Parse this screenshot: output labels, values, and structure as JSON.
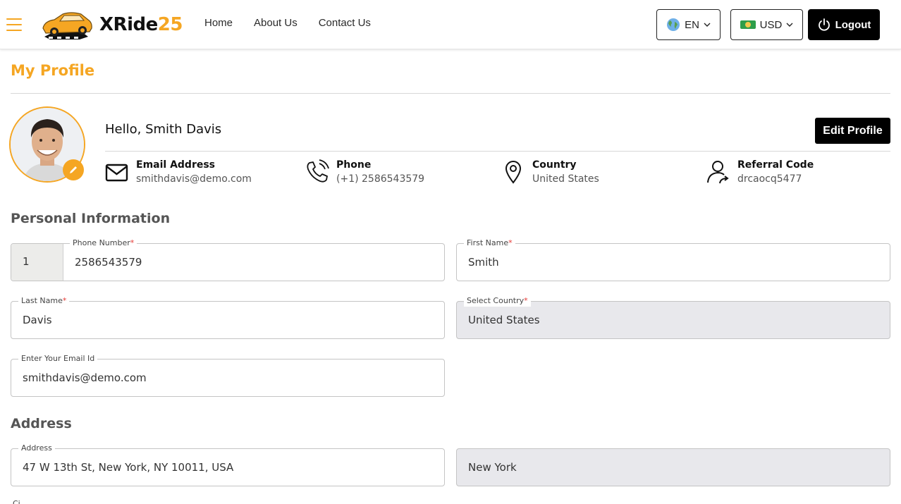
{
  "header": {
    "brand_main": "XRide",
    "brand_accent": "25",
    "nav": [
      "Home",
      "About Us",
      "Contact Us"
    ],
    "language": "EN",
    "currency": "USD",
    "logout": "Logout"
  },
  "page": {
    "title": "My Profile"
  },
  "profile": {
    "greeting": "Hello, Smith Davis",
    "edit_button": "Edit Profile",
    "info": {
      "email_label": "Email Address",
      "email_value": "smithdavis@demo.com",
      "phone_label": "Phone",
      "phone_value": "(+1) 2586543579",
      "country_label": "Country",
      "country_value": "United States",
      "referral_label": "Referral Code",
      "referral_value": "drcaocq5477"
    }
  },
  "personal": {
    "title": "Personal Information",
    "phone_label": "Phone Number",
    "phone_code": "1",
    "phone_value": "2586543579",
    "first_name_label": "First Name",
    "first_name_value": "Smith",
    "last_name_label": "Last Name",
    "last_name_value": "Davis",
    "country_label": "Select Country",
    "country_value": "United States",
    "email_label": "Enter Your Email Id",
    "email_value": "smithdavis@demo.com",
    "required_mark": "*"
  },
  "address": {
    "title": "Address",
    "address_label": "Address",
    "address_value": "47 W 13th St, New York, NY 10011, USA",
    "city_value": "New York",
    "next_label_partial": "Ci"
  },
  "colors": {
    "accent": "#f5a623",
    "dark": "#000000",
    "required": "#e53935",
    "disabled_bg": "#e8e8ec"
  }
}
